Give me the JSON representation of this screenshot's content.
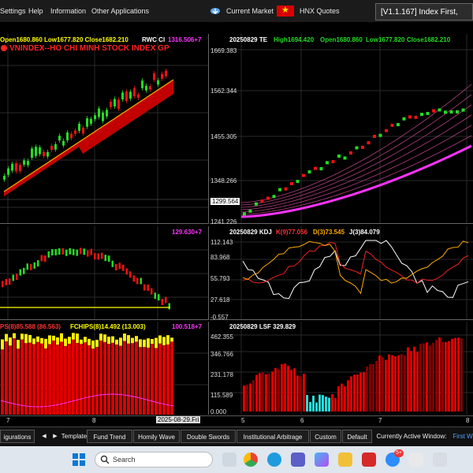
{
  "menu": {
    "settings": "Settings",
    "help": "Help",
    "information": "Information",
    "other_apps": "Other Applications",
    "current_market": "Current Market",
    "hnx_quotes": "HNX Quotes",
    "version": "[V1.1.167] Index First,"
  },
  "left_top": {
    "title_ohlc": "Open1680.860 Low1677.820 Close1682.210",
    "title_name": "VNINDEX--HO CHI MINH STOCK INDEX  GP",
    "rwc": "RWC Cl",
    "value": "1316.506+7"
  },
  "left_mid": {
    "value": "129.630+7"
  },
  "left_bot": {
    "label_a": "PS(8)85.588 (86.563)",
    "label_b": "FCHIPS(8)14.492 (13.003)",
    "value": "100.518+7"
  },
  "right_top": {
    "date": "20250829 TE",
    "high": "High1694.420",
    "open": "Open1680.860",
    "low": "Low1677.820",
    "close": "Close1682.210",
    "yticks": [
      "1669.383",
      "1562.344",
      "1455.305",
      "1348.266",
      "1299.564",
      "1241.226"
    ]
  },
  "right_mid": {
    "date": "20250829 KDJ",
    "k": "K(9)77.056",
    "d": "D(3)73.545",
    "j": "J(3)84.079",
    "yticks": [
      "112.143",
      "83.968",
      "55.793",
      "27.618",
      "-0.557"
    ]
  },
  "right_bot": {
    "date": "20250829 LSF 329.829",
    "yticks": [
      "462.355",
      "346.766",
      "231.178",
      "115.589",
      "0.000"
    ]
  },
  "xaxis": {
    "left": [
      "7",
      "8"
    ],
    "date_box": "2025-08-29.Fri",
    "right": [
      "5",
      "6",
      "7",
      "8"
    ]
  },
  "tabs": {
    "configurations": "igurations",
    "template": "Template",
    "fund_trend": "Fund Trend",
    "homily_wave": "Homily Wave",
    "double_swords": "Double Swords",
    "institutional": "Institutional Arbitrage",
    "custom": "Custom",
    "default": "Default",
    "active_window_label": "Currently Active Window:",
    "active_window_value": "First W"
  },
  "taskbar": {
    "search": "Search",
    "badge": "5+"
  },
  "colors": {
    "up": "#22dd22",
    "down": "#ee1111",
    "ema": "#ff33ff",
    "kdj_k": "#ffffff",
    "kdj_d": "#ee2222",
    "kdj_j": "#ffaa00"
  }
}
